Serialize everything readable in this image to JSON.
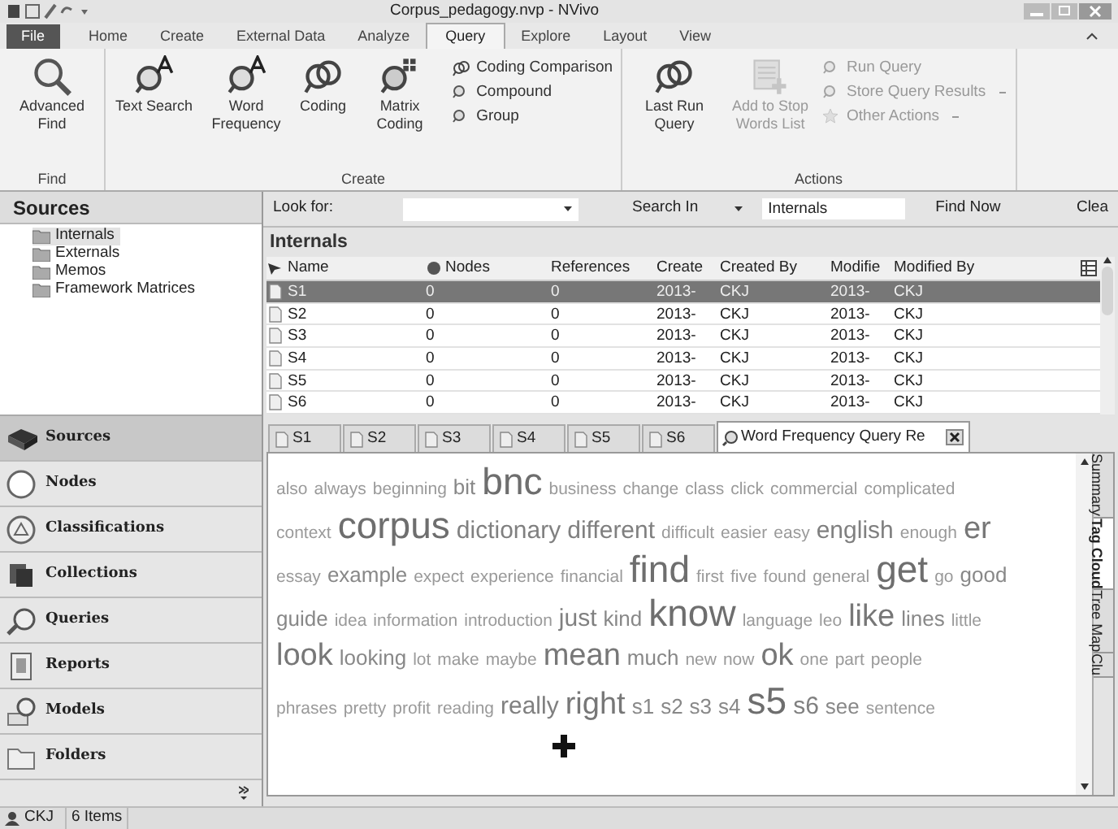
{
  "window": {
    "title": "Corpus_pedagogy.nvp - NVivo"
  },
  "file_menu": {
    "label": "File"
  },
  "ribbon_tabs": [
    {
      "label": "Home",
      "kind": "tab",
      "selected": false
    },
    {
      "label": "Create",
      "kind": "tab",
      "selected": false
    },
    {
      "label": "External Data",
      "kind": "tab",
      "selected": false
    },
    {
      "label": "Analyze",
      "kind": "tab",
      "selected": false
    },
    {
      "label": "Query",
      "kind": "tab",
      "selected": true
    },
    {
      "label": "Explore",
      "kind": "tab",
      "selected": false
    },
    {
      "label": "Layout",
      "kind": "tab",
      "selected": false
    },
    {
      "label": "View",
      "kind": "tab",
      "selected": false
    }
  ],
  "ribbon_groups": [
    {
      "label": "Find",
      "items": [
        {
          "label": "Advanced Find",
          "kind": "large",
          "disabled": false
        }
      ]
    },
    {
      "label": "Create",
      "items": [
        {
          "label": "Text Search",
          "kind": "large",
          "disabled": false
        },
        {
          "label": "Word Frequency",
          "kind": "large",
          "disabled": false
        },
        {
          "label": "Coding",
          "kind": "large",
          "disabled": false
        },
        {
          "label": "Matrix Coding",
          "kind": "large",
          "disabled": false
        },
        {
          "label": "Coding Comparison",
          "kind": "small",
          "disabled": false,
          "dropdown": false
        },
        {
          "label": "Compound",
          "kind": "small",
          "disabled": false,
          "dropdown": false
        },
        {
          "label": "Group",
          "kind": "small",
          "disabled": false,
          "dropdown": false
        }
      ]
    },
    {
      "label": "Actions",
      "items": [
        {
          "label": "Last Run Query",
          "kind": "large",
          "disabled": false
        },
        {
          "label": "Add to Stop Words List",
          "kind": "large",
          "disabled": true
        },
        {
          "label": "Run Query",
          "kind": "small",
          "disabled": true,
          "dropdown": false
        },
        {
          "label": "Store Query Results",
          "kind": "small",
          "disabled": true,
          "dropdown": true
        },
        {
          "label": "Other Actions",
          "kind": "small",
          "disabled": true,
          "dropdown": true
        }
      ]
    }
  ],
  "sources": {
    "title": "Sources",
    "items": [
      {
        "label": "Internals",
        "selected": true
      },
      {
        "label": "Externals",
        "selected": false
      },
      {
        "label": "Memos",
        "selected": false
      },
      {
        "label": "Framework Matrices",
        "selected": false
      }
    ]
  },
  "navigation": [
    {
      "label": "Sources",
      "selected": true
    },
    {
      "label": "Nodes",
      "selected": false
    },
    {
      "label": "Classifications",
      "selected": false
    },
    {
      "label": "Collections",
      "selected": false
    },
    {
      "label": "Queries",
      "selected": false
    },
    {
      "label": "Reports",
      "selected": false
    },
    {
      "label": "Models",
      "selected": false
    },
    {
      "label": "Folders",
      "selected": false
    }
  ],
  "find_bar": {
    "look_for_label": "Look for:",
    "search_in_label": "Search In",
    "search_in_value": "Internals",
    "find_now": "Find Now",
    "clear": "Clea"
  },
  "table": {
    "title": "Internals",
    "columns": [
      "Name",
      "Nodes",
      "References",
      "Create",
      "Created By",
      "Modifie",
      "Modified By"
    ],
    "rows": [
      {
        "cells": [
          "S1",
          "0",
          "0",
          "2013-",
          "CKJ",
          "2013-",
          "CKJ"
        ],
        "selected": true
      },
      {
        "cells": [
          "S2",
          "0",
          "0",
          "2013-",
          "CKJ",
          "2013-",
          "CKJ"
        ],
        "selected": false
      },
      {
        "cells": [
          "S3",
          "0",
          "0",
          "2013-",
          "CKJ",
          "2013-",
          "CKJ"
        ],
        "selected": false
      },
      {
        "cells": [
          "S4",
          "0",
          "0",
          "2013-",
          "CKJ",
          "2013-",
          "CKJ"
        ],
        "selected": false
      },
      {
        "cells": [
          "S5",
          "0",
          "0",
          "2013-",
          "CKJ",
          "2013-",
          "CKJ"
        ],
        "selected": false
      },
      {
        "cells": [
          "S6",
          "0",
          "0",
          "2013-",
          "CKJ",
          "2013-",
          "CKJ"
        ],
        "selected": false
      }
    ]
  },
  "doc_tabs": [
    {
      "label": "S1",
      "kind": "document",
      "selected": false
    },
    {
      "label": "S2",
      "kind": "document",
      "selected": false
    },
    {
      "label": "S3",
      "kind": "document",
      "selected": false
    },
    {
      "label": "S4",
      "kind": "document",
      "selected": false
    },
    {
      "label": "S5",
      "kind": "document",
      "selected": false
    },
    {
      "label": "S6",
      "kind": "document",
      "selected": false
    },
    {
      "label": "Word Frequency Query Re",
      "kind": "query",
      "selected": true
    }
  ],
  "view_tabs": [
    {
      "label": "Summary",
      "selected": false
    },
    {
      "label": "Tag Cloud",
      "selected": true
    },
    {
      "label": "Tree Map",
      "selected": false
    },
    {
      "label": "Clu",
      "selected": false
    }
  ],
  "word_cloud": [
    [
      {
        "text": "also",
        "kind": "small"
      },
      {
        "text": "always",
        "kind": "small"
      },
      {
        "text": "beginning",
        "kind": "small"
      },
      {
        "text": "bit",
        "kind": "medium"
      },
      {
        "text": "bnc",
        "kind": "biggest"
      },
      {
        "text": "business",
        "kind": "small"
      },
      {
        "text": "change",
        "kind": "small"
      },
      {
        "text": "class",
        "kind": "small"
      },
      {
        "text": "click",
        "kind": "small"
      },
      {
        "text": "commercial",
        "kind": "small"
      },
      {
        "text": "complicated",
        "kind": "small"
      }
    ],
    [
      {
        "text": "context",
        "kind": "small"
      },
      {
        "text": "corpus",
        "kind": "biggest"
      },
      {
        "text": "dictionary",
        "kind": "large"
      },
      {
        "text": "different",
        "kind": "large"
      },
      {
        "text": "difficult",
        "kind": "small"
      },
      {
        "text": "easier",
        "kind": "small"
      },
      {
        "text": "easy",
        "kind": "small"
      },
      {
        "text": "english",
        "kind": "large"
      },
      {
        "text": "enough",
        "kind": "small"
      },
      {
        "text": "er",
        "kind": "huge"
      }
    ],
    [
      {
        "text": "essay",
        "kind": "small"
      },
      {
        "text": "example",
        "kind": "medium"
      },
      {
        "text": "expect",
        "kind": "small"
      },
      {
        "text": "experience",
        "kind": "small"
      },
      {
        "text": "financial",
        "kind": "small"
      },
      {
        "text": "find",
        "kind": "biggest"
      },
      {
        "text": "first",
        "kind": "small"
      },
      {
        "text": "five",
        "kind": "small"
      },
      {
        "text": "found",
        "kind": "small"
      },
      {
        "text": "general",
        "kind": "small"
      },
      {
        "text": "get",
        "kind": "biggest"
      },
      {
        "text": "go",
        "kind": "small"
      },
      {
        "text": "good",
        "kind": "medium"
      }
    ],
    [
      {
        "text": "guide",
        "kind": "medium"
      },
      {
        "text": "idea",
        "kind": "small"
      },
      {
        "text": "information",
        "kind": "small"
      },
      {
        "text": "introduction",
        "kind": "small"
      },
      {
        "text": "just",
        "kind": "large"
      },
      {
        "text": "kind",
        "kind": "medium"
      },
      {
        "text": "know",
        "kind": "biggest"
      },
      {
        "text": "language",
        "kind": "small"
      },
      {
        "text": "leo",
        "kind": "small"
      },
      {
        "text": "like",
        "kind": "huge"
      },
      {
        "text": "lines",
        "kind": "medium"
      },
      {
        "text": "little",
        "kind": "small"
      }
    ],
    [
      {
        "text": "look",
        "kind": "huge"
      },
      {
        "text": "looking",
        "kind": "medium"
      },
      {
        "text": "lot",
        "kind": "small"
      },
      {
        "text": "make",
        "kind": "small"
      },
      {
        "text": "maybe",
        "kind": "small"
      },
      {
        "text": "mean",
        "kind": "huge"
      },
      {
        "text": "much",
        "kind": "medium"
      },
      {
        "text": "new",
        "kind": "small"
      },
      {
        "text": "now",
        "kind": "small"
      },
      {
        "text": "ok",
        "kind": "huge"
      },
      {
        "text": "one",
        "kind": "small"
      },
      {
        "text": "part",
        "kind": "small"
      },
      {
        "text": "people",
        "kind": "small"
      }
    ],
    [
      {
        "text": "phrases",
        "kind": "small"
      },
      {
        "text": "pretty",
        "kind": "small"
      },
      {
        "text": "profit",
        "kind": "small"
      },
      {
        "text": "reading",
        "kind": "small"
      },
      {
        "text": "really",
        "kind": "large"
      },
      {
        "text": "right",
        "kind": "huge"
      },
      {
        "text": "s1",
        "kind": "medium"
      },
      {
        "text": "s2",
        "kind": "medium"
      },
      {
        "text": "s3",
        "kind": "medium"
      },
      {
        "text": "s4",
        "kind": "medium"
      },
      {
        "text": "s5",
        "kind": "biggest"
      },
      {
        "text": "s6",
        "kind": "large"
      },
      {
        "text": "see",
        "kind": "medium"
      },
      {
        "text": "sentence",
        "kind": "small"
      }
    ]
  ],
  "status_bar": {
    "user": "CKJ",
    "items": "6 Items"
  }
}
